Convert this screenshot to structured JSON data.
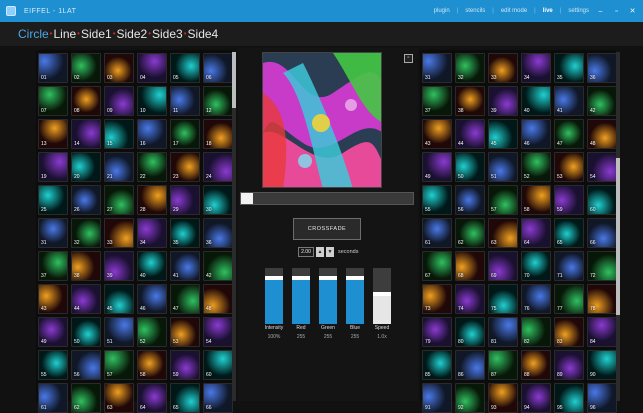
{
  "app": {
    "title": "EIFFEL - 1LAT"
  },
  "titlebar_menu": [
    {
      "label": "plugin",
      "active": false
    },
    {
      "label": "stencils",
      "active": false
    },
    {
      "label": "edit mode",
      "active": false
    },
    {
      "label": "live",
      "active": true
    },
    {
      "label": "settings",
      "active": false
    }
  ],
  "window_buttons": {
    "minimize": "–",
    "restore": "▫",
    "close": "✕"
  },
  "tabs": [
    {
      "label": "Circle",
      "active": true
    },
    {
      "label": "Line",
      "active": false
    },
    {
      "label": "Side1",
      "active": false
    },
    {
      "label": "Side2",
      "active": false
    },
    {
      "label": "Side3",
      "active": false
    },
    {
      "label": "Side4",
      "active": false
    }
  ],
  "tab_separator": "•",
  "left_library": {
    "tiles": [
      "01",
      "02",
      "03",
      "04",
      "05",
      "06",
      "07",
      "08",
      "09",
      "10",
      "11",
      "12",
      "13",
      "14",
      "15",
      "16",
      "17",
      "18",
      "19",
      "20",
      "21",
      "22",
      "23",
      "24",
      "25",
      "26",
      "27",
      "28",
      "29",
      "30",
      "31",
      "32",
      "33",
      "34",
      "35",
      "36",
      "37",
      "38",
      "39",
      "40",
      "41",
      "42",
      "43",
      "44",
      "45",
      "46",
      "47",
      "48",
      "49",
      "50",
      "51",
      "52",
      "53",
      "54",
      "55",
      "56",
      "57",
      "58",
      "59",
      "60",
      "61",
      "62",
      "63",
      "64",
      "65",
      "66"
    ],
    "scroll": {
      "position": 0.0,
      "visible_fraction": 0.16
    }
  },
  "right_library": {
    "tiles": [
      "31",
      "32",
      "33",
      "34",
      "35",
      "36",
      "37",
      "38",
      "39",
      "40",
      "41",
      "42",
      "43",
      "44",
      "45",
      "46",
      "47",
      "48",
      "49",
      "50",
      "51",
      "52",
      "53",
      "54",
      "55",
      "56",
      "57",
      "58",
      "59",
      "60",
      "61",
      "62",
      "63",
      "64",
      "65",
      "66",
      "67",
      "68",
      "69",
      "70",
      "71",
      "72",
      "73",
      "74",
      "75",
      "76",
      "77",
      "78",
      "79",
      "80",
      "81",
      "82",
      "83",
      "84",
      "85",
      "86",
      "87",
      "88",
      "89",
      "90",
      "91",
      "92",
      "93",
      "94",
      "95",
      "96"
    ],
    "scroll": {
      "position": 0.55,
      "visible_fraction": 0.45
    }
  },
  "preview": {
    "close_label": "▫",
    "progress": 0.07
  },
  "crossfade": {
    "button_label": "CROSSFADE",
    "duration": "2.00",
    "up": "▲",
    "down": "▼",
    "unit": "seconds"
  },
  "sliders": [
    {
      "label": "Intensity",
      "value": "100%",
      "level": 0.78
    },
    {
      "label": "Red",
      "value": "255",
      "level": 0.78
    },
    {
      "label": "Green",
      "value": "255",
      "level": 0.78
    },
    {
      "label": "Blue",
      "value": "255",
      "level": 0.78
    },
    {
      "label": "Speed",
      "value": "1.0x",
      "level": 0.5
    }
  ],
  "colors": {
    "accent": "#1e8fd0",
    "tab_active": "#4aa8e6",
    "separator": "#d02727"
  }
}
